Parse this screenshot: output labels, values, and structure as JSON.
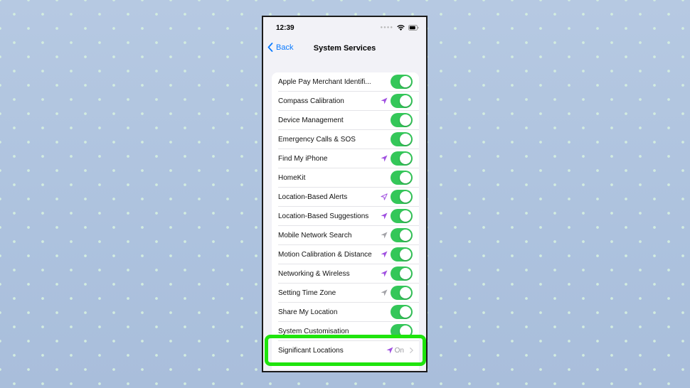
{
  "status_bar": {
    "time": "12:39"
  },
  "nav": {
    "back_label": "Back",
    "title": "System Services"
  },
  "colors": {
    "toggle_on": "#34c759",
    "accent": "#0a7aff",
    "location_active": "#a050e0",
    "location_recent": "#8e8e93",
    "highlight": "#1fe40d"
  },
  "services": [
    {
      "label": "Apple Pay Merchant Identifi...",
      "location_icon": "none",
      "enabled": true
    },
    {
      "label": "Compass Calibration",
      "location_icon": "filled-purple-arrow-icon",
      "enabled": true
    },
    {
      "label": "Device Management",
      "location_icon": "none",
      "enabled": true
    },
    {
      "label": "Emergency Calls & SOS",
      "location_icon": "none",
      "enabled": true
    },
    {
      "label": "Find My iPhone",
      "location_icon": "filled-purple-arrow-icon",
      "enabled": true
    },
    {
      "label": "HomeKit",
      "location_icon": "none",
      "enabled": true
    },
    {
      "label": "Location-Based Alerts",
      "location_icon": "outline-purple-arrow-icon",
      "enabled": true
    },
    {
      "label": "Location-Based Suggestions",
      "location_icon": "filled-purple-arrow-icon",
      "enabled": true
    },
    {
      "label": "Mobile Network Search",
      "location_icon": "filled-gray-arrow-icon",
      "enabled": true
    },
    {
      "label": "Motion Calibration & Distance",
      "location_icon": "filled-purple-arrow-icon",
      "enabled": true
    },
    {
      "label": "Networking & Wireless",
      "location_icon": "filled-purple-arrow-icon",
      "enabled": true
    },
    {
      "label": "Setting Time Zone",
      "location_icon": "filled-gray-arrow-icon",
      "enabled": true
    },
    {
      "label": "Share My Location",
      "location_icon": "none",
      "enabled": true
    },
    {
      "label": "System Customisation",
      "location_icon": "none",
      "enabled": true
    }
  ],
  "significant_locations": {
    "label": "Significant Locations",
    "location_icon": "filled-purple-arrow-icon",
    "value": "On"
  }
}
